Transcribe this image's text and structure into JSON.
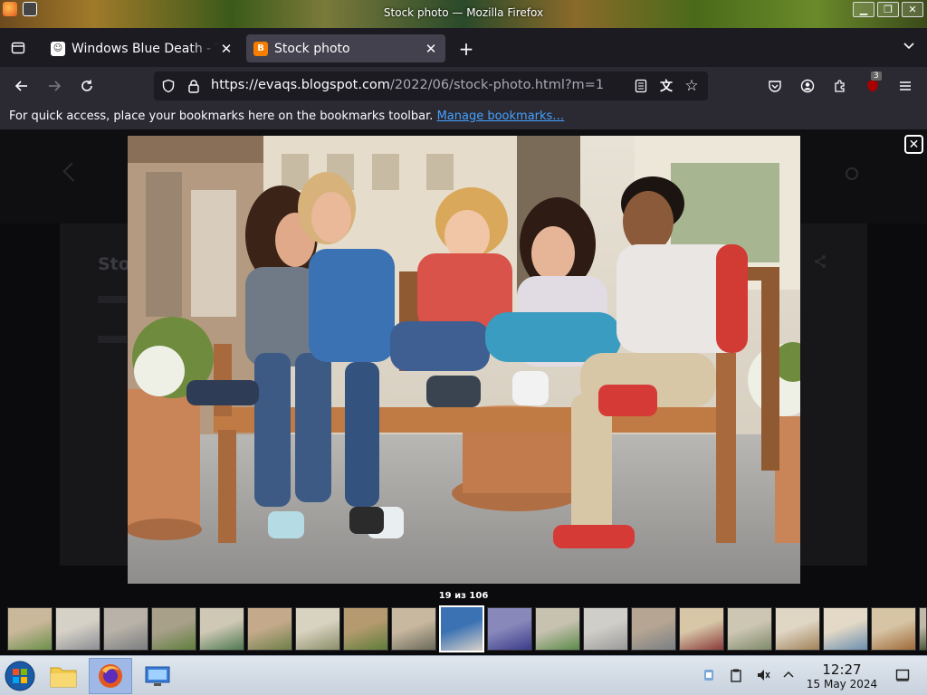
{
  "window": {
    "title": "Stock photo — Mozilla Firefox",
    "controls": [
      "minimize",
      "maximize",
      "close"
    ]
  },
  "tabs": [
    {
      "label": "Windows Blue Death - Te",
      "favicon": "ghost-favicon",
      "active": false
    },
    {
      "label": "Stock photo",
      "favicon": "blogger-favicon",
      "active": true,
      "accent": "#f57d00"
    }
  ],
  "toolbar": {
    "url_domain": "https://evaqs.blogspot.com",
    "url_path": "/2022/06/stock-photo.html?m=1",
    "extensions_badge": "3"
  },
  "bookmarks_bar": {
    "message": "For quick access, place your bookmarks here on the bookmarks toolbar.",
    "link": "Manage bookmarks…"
  },
  "lightbox": {
    "counter": "19 из 106",
    "close_icon": "close-icon",
    "thumbnail_count": 20,
    "active_thumbnail_index": 9
  },
  "background_page": {
    "title_fragment": "Sto"
  },
  "taskbar": {
    "time": "12:27",
    "date": "15 May 2024",
    "apps": [
      "start-orb",
      "file-manager",
      "firefox",
      "system-settings"
    ]
  }
}
